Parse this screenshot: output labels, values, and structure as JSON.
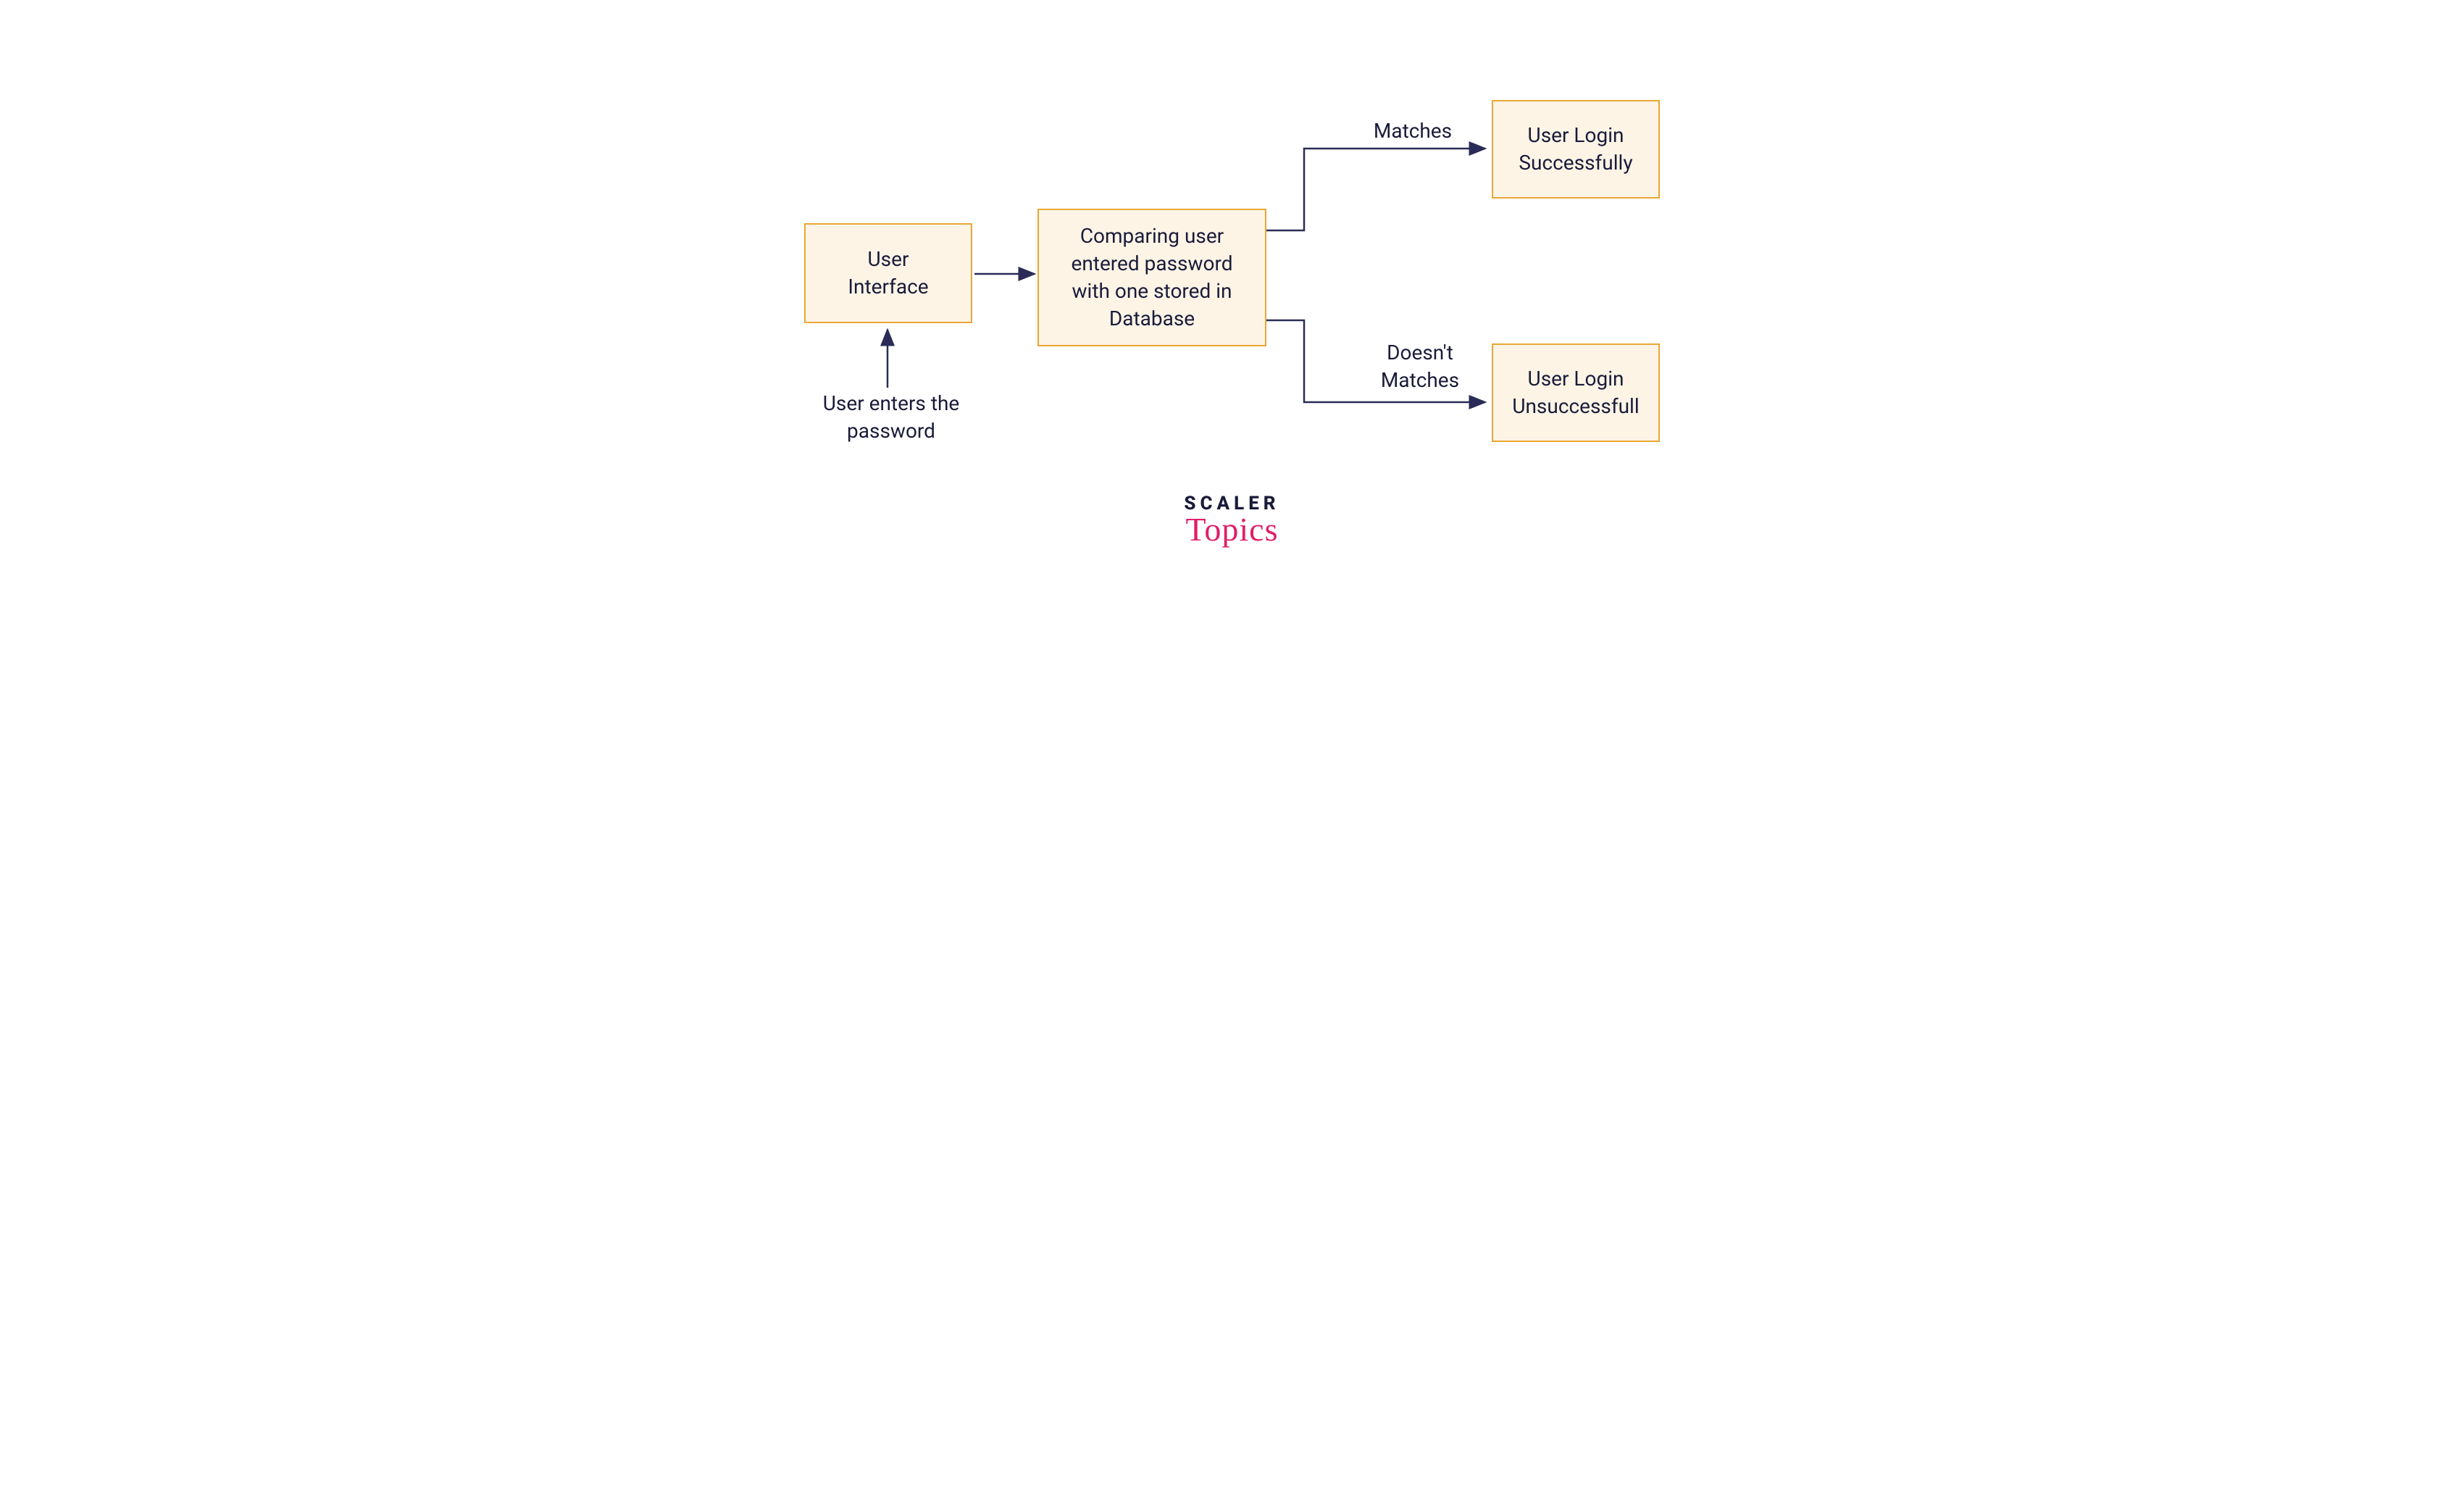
{
  "nodes": {
    "ui": {
      "text": "User\nInterface"
    },
    "compare": {
      "text": "Comparing user entered password with one stored in Database"
    },
    "success": {
      "text": "User Login Successfully"
    },
    "fail": {
      "text": "User Login Unsuccessfull"
    }
  },
  "labels": {
    "input": "User enters the password",
    "matches": "Matches",
    "nomatch": "Doesn't Matches"
  },
  "brand": {
    "line1": "SCALER",
    "line2": "Topics"
  },
  "colors": {
    "box_fill": "#fdf4e6",
    "box_border": "#e9a735",
    "text": "#1a1b3a",
    "arrow": "#2a2c57",
    "accent": "#e01e69"
  }
}
